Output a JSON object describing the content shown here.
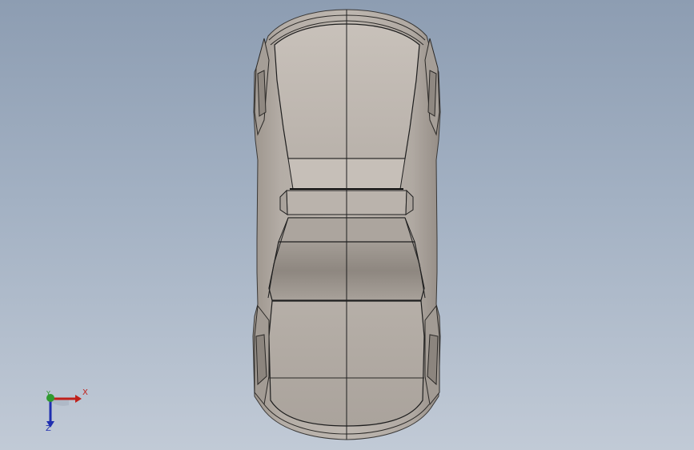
{
  "viewport": {
    "background_top": "#8d9db2",
    "background_bottom": "#c1cad6",
    "model": {
      "body_color": "#b3aca5",
      "edge_color": "#1e1e1e"
    }
  },
  "triad": {
    "x_label": "X",
    "y_label": "Y",
    "z_label": "Z",
    "x_color": "#c0201a",
    "y_color": "#2f9a2f",
    "z_color": "#1f2fb0"
  }
}
